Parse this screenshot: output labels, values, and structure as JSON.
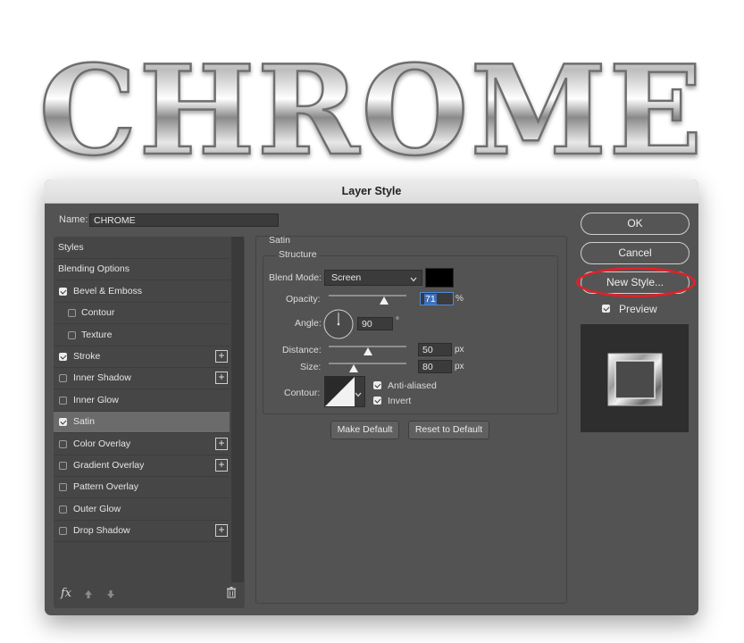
{
  "banner": {
    "text": "CHROME"
  },
  "dialog": {
    "title": "Layer Style",
    "name_label": "Name:",
    "name_value": "CHROME",
    "styles_list": [
      {
        "label": "Styles",
        "checkbox": false,
        "checked": false,
        "plus": false,
        "indent": 0
      },
      {
        "label": "Blending Options",
        "checkbox": false,
        "checked": false,
        "plus": false,
        "indent": 0
      },
      {
        "label": "Bevel & Emboss",
        "checkbox": true,
        "checked": true,
        "plus": false,
        "indent": 0
      },
      {
        "label": "Contour",
        "checkbox": true,
        "checked": false,
        "plus": false,
        "indent": 1
      },
      {
        "label": "Texture",
        "checkbox": true,
        "checked": false,
        "plus": false,
        "indent": 1
      },
      {
        "label": "Stroke",
        "checkbox": true,
        "checked": true,
        "plus": true,
        "indent": 0
      },
      {
        "label": "Inner Shadow",
        "checkbox": true,
        "checked": false,
        "plus": true,
        "indent": 0
      },
      {
        "label": "Inner Glow",
        "checkbox": true,
        "checked": false,
        "plus": false,
        "indent": 0
      },
      {
        "label": "Satin",
        "checkbox": true,
        "checked": true,
        "plus": false,
        "indent": 0,
        "selected": true
      },
      {
        "label": "Color Overlay",
        "checkbox": true,
        "checked": false,
        "plus": true,
        "indent": 0
      },
      {
        "label": "Gradient Overlay",
        "checkbox": true,
        "checked": false,
        "plus": true,
        "indent": 0
      },
      {
        "label": "Pattern Overlay",
        "checkbox": true,
        "checked": false,
        "plus": false,
        "indent": 0
      },
      {
        "label": "Outer Glow",
        "checkbox": true,
        "checked": false,
        "plus": false,
        "indent": 0
      },
      {
        "label": "Drop Shadow",
        "checkbox": true,
        "checked": false,
        "plus": true,
        "indent": 0
      }
    ],
    "bottom_icons": {
      "fx": "fx"
    },
    "satin": {
      "section_title": "Satin",
      "structure_title": "Structure",
      "blend_mode_label": "Blend Mode:",
      "blend_mode_value": "Screen",
      "satin_color": "#000000",
      "opacity_label": "Opacity:",
      "opacity_value": "71",
      "opacity_unit": "%",
      "angle_label": "Angle:",
      "angle_value": "90",
      "angle_unit": "°",
      "distance_label": "Distance:",
      "distance_value": "50",
      "distance_unit": "px",
      "size_label": "Size:",
      "size_value": "80",
      "size_unit": "px",
      "contour_label": "Contour:",
      "anti_aliased_label": "Anti-aliased",
      "anti_aliased_checked": true,
      "invert_label": "Invert",
      "invert_checked": true
    },
    "make_default_label": "Make Default",
    "reset_default_label": "Reset to Default",
    "ok_label": "OK",
    "cancel_label": "Cancel",
    "new_style_label": "New Style...",
    "preview_label": "Preview",
    "preview_checked": true,
    "highlight_color": "#e0202a"
  }
}
